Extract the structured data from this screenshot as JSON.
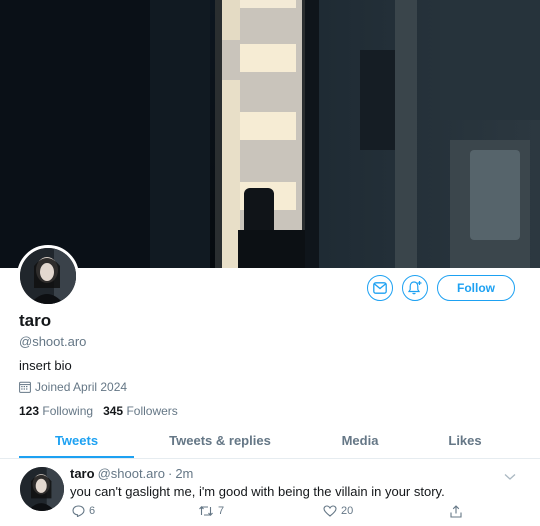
{
  "profile": {
    "name": "taro",
    "handle": "@shoot.aro",
    "bio": "insert bio",
    "joined": "Joined April 2024",
    "following_count": "123",
    "following_label": "Following",
    "followers_count": "345",
    "followers_label": "Followers"
  },
  "actions": {
    "follow_label": "Follow",
    "message_icon": "envelope-icon",
    "notify_icon": "bell-plus-icon"
  },
  "tabs": [
    {
      "label": "Tweets",
      "active": true
    },
    {
      "label": "Tweets & replies",
      "active": false
    },
    {
      "label": "Media",
      "active": false
    },
    {
      "label": "Likes",
      "active": false
    }
  ],
  "tweet": {
    "name": "taro",
    "handle": "@shoot.aro",
    "separator": "·",
    "time": "2m",
    "text": "you can't gaslight me, i'm good with being the villain in your story.",
    "replies": "6",
    "retweets": "7",
    "likes": "20"
  },
  "colors": {
    "accent": "#1da1f2",
    "secondary_text": "#657786"
  }
}
